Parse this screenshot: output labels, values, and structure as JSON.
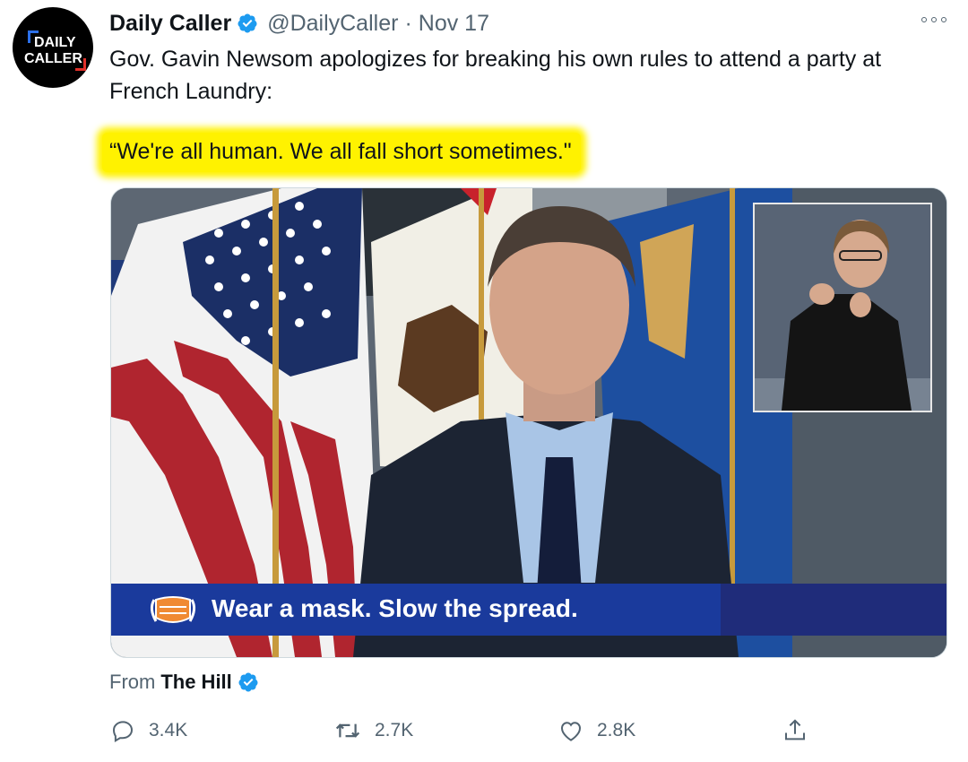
{
  "tweet": {
    "author_name": "Daily Caller",
    "handle": "@DailyCaller",
    "separator": "·",
    "date": "Nov 17",
    "avatar_line1": "DAILY",
    "avatar_line2": "CALLER",
    "text": "Gov. Gavin Newsom apologizes for breaking his own rules to attend a party at French Laundry:",
    "quote": "“We're all human. We all fall short sometimes.\"",
    "highlight_color": "#fff200",
    "verified_icon": "verified-badge-icon"
  },
  "media": {
    "caption": "Wear a mask. Slow the spread.",
    "caption_bar_color": "#1a3a9c",
    "mask_icon": "face-mask-icon"
  },
  "source": {
    "prefix": "From",
    "name": "The Hill"
  },
  "actions": {
    "reply_count": "3.4K",
    "retweet_count": "2.7K",
    "like_count": "2.8K",
    "reply_icon": "reply-icon",
    "retweet_icon": "retweet-icon",
    "like_icon": "heart-icon",
    "share_icon": "share-icon"
  },
  "colors": {
    "verified": "#1d9bf0",
    "secondary_text": "#536471"
  }
}
